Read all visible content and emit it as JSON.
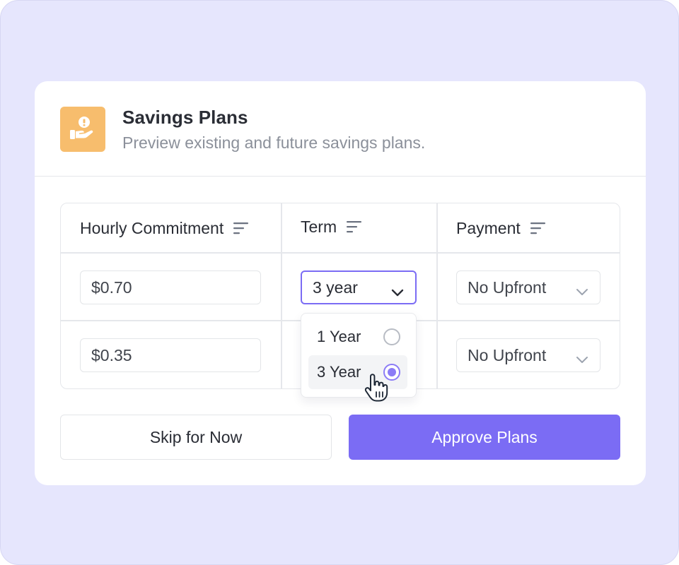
{
  "header": {
    "icon": "hand-coin-icon",
    "title": "Savings Plans",
    "subtitle": "Preview existing and future savings plans."
  },
  "table": {
    "columns": [
      {
        "label": "Hourly Commitment",
        "icon": "sort-icon"
      },
      {
        "label": "Term",
        "icon": "sort-icon"
      },
      {
        "label": "Payment",
        "icon": "sort-icon"
      }
    ],
    "rows": [
      {
        "hourly": "$0.70",
        "term": "3 year",
        "payment": "No Upfront"
      },
      {
        "hourly": "$0.35",
        "term": "",
        "payment": "No Upfront"
      }
    ]
  },
  "term_dropdown": {
    "open": true,
    "options": [
      {
        "label": "1 Year",
        "selected": false
      },
      {
        "label": "3 Year",
        "selected": true
      }
    ]
  },
  "actions": {
    "skip_label": "Skip for Now",
    "approve_label": "Approve Plans"
  },
  "colors": {
    "background": "#e6e6fd",
    "accent": "#7b6cf4",
    "icon_bg": "#f7bd6d"
  }
}
